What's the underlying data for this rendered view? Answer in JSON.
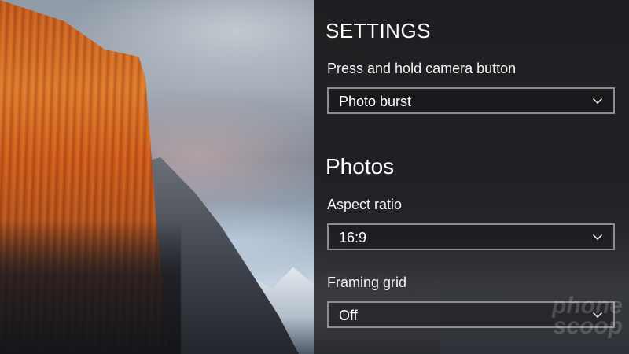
{
  "settings": {
    "title": "SETTINGS",
    "camera_button": {
      "label": "Press and hold camera button",
      "value": "Photo burst"
    }
  },
  "photos": {
    "title": "Photos",
    "aspect_ratio": {
      "label": "Aspect ratio",
      "value": "16:9"
    },
    "framing_grid": {
      "label": "Framing grid",
      "value": "Off"
    }
  },
  "icons": {
    "dropdown": "chevron-down-icon"
  },
  "watermark": {
    "text": "phone scoop"
  }
}
